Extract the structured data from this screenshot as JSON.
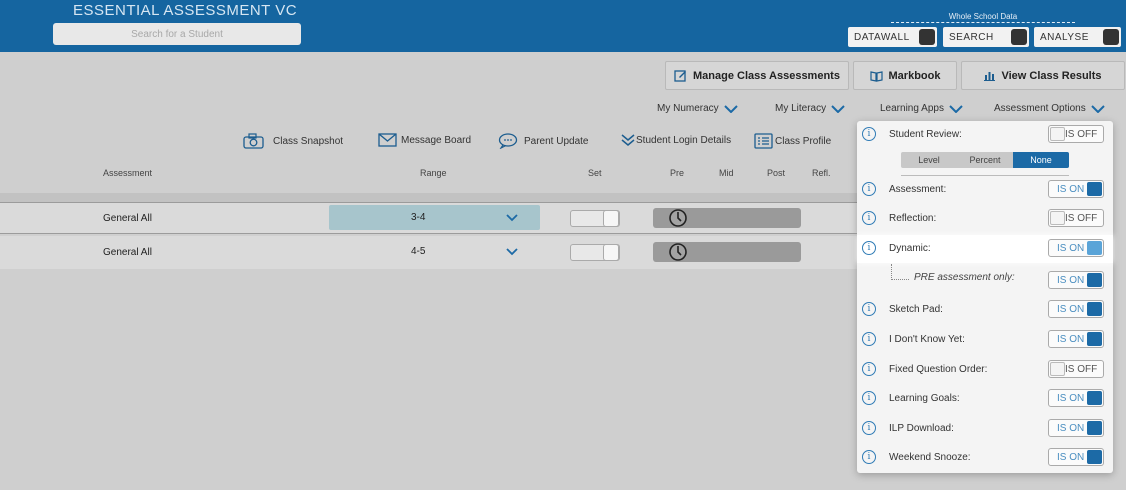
{
  "header": {
    "title": "ESSENTIAL ASSESSMENT VC",
    "search_placeholder": "Search for a Student",
    "whole_school_label": "Whole School Data",
    "buttons": [
      "DATAWALL",
      "SEARCH",
      "ANALYSE"
    ]
  },
  "actions": {
    "manage": "Manage Class Assessments",
    "markbook": "Markbook",
    "results": "View Class Results"
  },
  "menus": [
    "My Numeracy",
    "My Literacy",
    "Learning Apps",
    "Assessment Options"
  ],
  "toolbar": {
    "snapshot": "Class Snapshot",
    "message": "Message Board",
    "parent": "Parent Update",
    "login": "Student Login Details",
    "profile": "Class Profile"
  },
  "columns": {
    "assessment": "Assessment",
    "range": "Range",
    "set": "Set",
    "pre": "Pre",
    "mid": "Mid",
    "post": "Post",
    "refl": "Refl."
  },
  "rows": [
    {
      "assessment": "General All",
      "range": "3-4"
    },
    {
      "assessment": "General All",
      "range": "4-5"
    }
  ],
  "options": {
    "student_review": {
      "label": "Student Review:",
      "state": "IS OFF"
    },
    "segments": [
      "Level",
      "Percent",
      "None"
    ],
    "segment_selected": "None",
    "assessment": {
      "label": "Assessment:",
      "state": "IS ON"
    },
    "reflection": {
      "label": "Reflection:",
      "state": "IS OFF"
    },
    "dynamic": {
      "label": "Dynamic:",
      "state": "IS ON"
    },
    "pre_only": {
      "label": "PRE assessment only:",
      "state": "IS ON"
    },
    "sketch_pad": {
      "label": "Sketch Pad:",
      "state": "IS ON"
    },
    "dont_know": {
      "label": "I Don't Know Yet:",
      "state": "IS ON"
    },
    "fixed_order": {
      "label": "Fixed Question Order:",
      "state": "IS OFF"
    },
    "learning_goals": {
      "label": "Learning Goals:",
      "state": "IS ON"
    },
    "ilp_download": {
      "label": "ILP Download:",
      "state": "IS ON"
    },
    "weekend_snooze": {
      "label": "Weekend Snooze:",
      "state": "IS ON"
    }
  },
  "colors": {
    "brand": "#1565a0",
    "accent": "#1c6aa6",
    "range_cell": "#a7c5cc"
  },
  "icons": {
    "info": "info-icon",
    "chevron": "chevron-down-icon",
    "clock": "clock-icon"
  }
}
